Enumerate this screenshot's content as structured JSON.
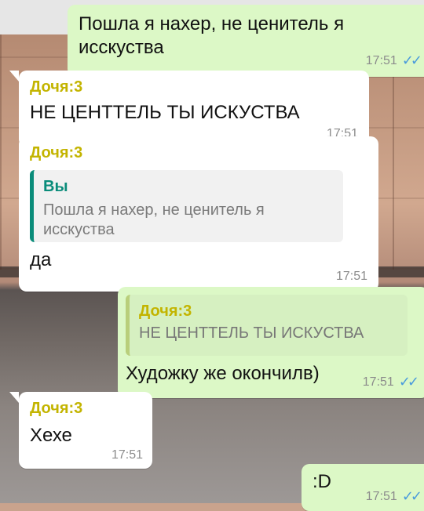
{
  "messages": [
    {
      "id": "m1",
      "direction": "outgoing",
      "text": "Пошла я нахер, не ценитель я исскуства",
      "time": "17:51",
      "status_icon": "double-check-icon"
    },
    {
      "id": "m2",
      "direction": "incoming",
      "sender": "Дочя:3",
      "text": "НЕ ЦЕНТТЕЛЬ ТЫ ИСКУСТВА",
      "time": "17:51"
    },
    {
      "id": "m3",
      "direction": "incoming",
      "sender": "Дочя:3",
      "quote": {
        "sender": "Вы",
        "text": "Пошла я нахер, не ценитель я исскуства"
      },
      "text": "да",
      "time": "17:51"
    },
    {
      "id": "m4",
      "direction": "outgoing",
      "quote": {
        "sender": "Дочя:3",
        "text": "НЕ ЦЕНТТЕЛЬ ТЫ ИСКУСТВА"
      },
      "text": "Художку же окончилв)",
      "time": "17:51",
      "status_icon": "double-check-icon"
    },
    {
      "id": "m5",
      "direction": "incoming",
      "sender": "Дочя:3",
      "text": "Хехе",
      "time": "17:51"
    },
    {
      "id": "m6",
      "direction": "outgoing",
      "text": ":D",
      "time": "17:51",
      "status_icon": "double-check-icon"
    }
  ],
  "colors": {
    "outgoing_bubble": "#dcf8c6",
    "incoming_bubble": "#ffffff",
    "sender_name": "#c3b400",
    "quote_bar_incoming": "#0a8c7a",
    "time_text": "#8c8c8c",
    "read_ticks": "#4a9bdc"
  }
}
